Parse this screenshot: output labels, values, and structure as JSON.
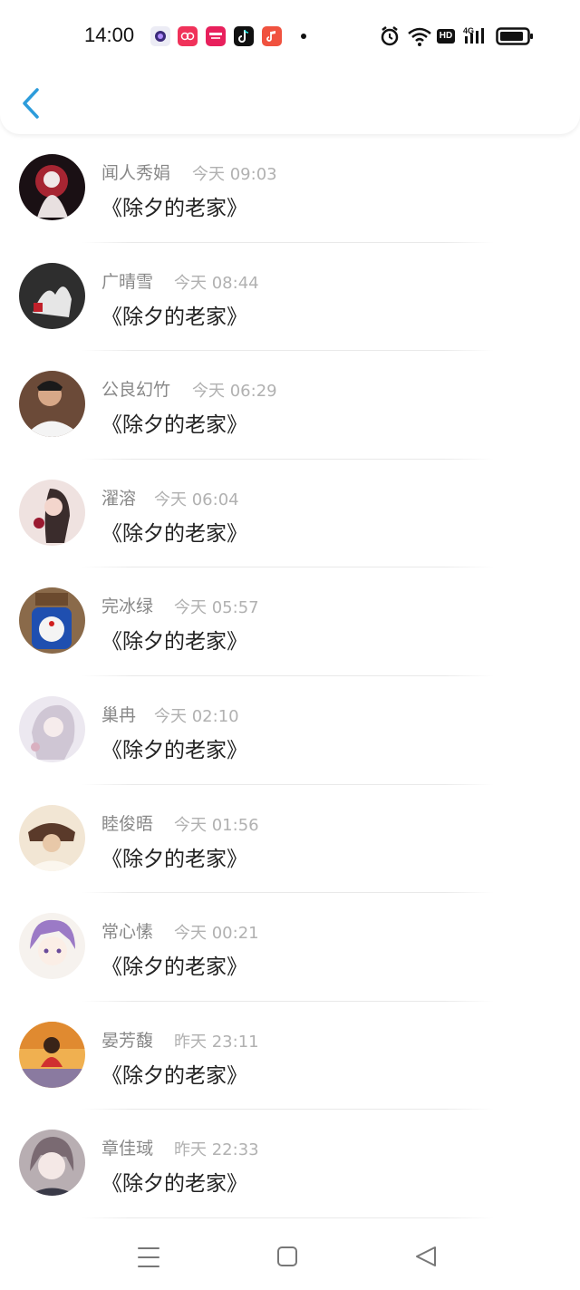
{
  "status_bar": {
    "time": "14:00",
    "app_icons": [
      "purple-dot-app-icon",
      "pink-app-icon",
      "pink-shop-app-icon",
      "tiktok-icon",
      "music-app-icon"
    ],
    "system_icons": [
      "alarm-icon",
      "wifi-icon",
      "hd-icon",
      "signal-4g-icon",
      "battery-icon"
    ],
    "hd_label": "HD",
    "network_label": "4G"
  },
  "header": {
    "back_icon": "chevron-left-icon"
  },
  "comments": [
    {
      "name": "闻人秀娟",
      "time": "今天 09:03",
      "title": "《除夕的老家》"
    },
    {
      "name": "广晴雪",
      "time": "今天 08:44",
      "title": "《除夕的老家》"
    },
    {
      "name": "公良幻竹",
      "time": "今天 06:29",
      "title": "《除夕的老家》"
    },
    {
      "name": "濯溶",
      "time": "今天 06:04",
      "title": "《除夕的老家》"
    },
    {
      "name": "完冰绿",
      "time": "今天 05:57",
      "title": "《除夕的老家》"
    },
    {
      "name": "巢冉",
      "time": "今天 02:10",
      "title": "《除夕的老家》"
    },
    {
      "name": "睦俊晤",
      "time": "今天 01:56",
      "title": "《除夕的老家》"
    },
    {
      "name": "常心愫",
      "time": "今天 00:21",
      "title": "《除夕的老家》"
    },
    {
      "name": "晏芳馥",
      "time": "昨天 23:11",
      "title": "《除夕的老家》"
    },
    {
      "name": "章佳琙",
      "time": "昨天 22:33",
      "title": "《除夕的老家》"
    }
  ],
  "nav_bar": {
    "items": [
      "menu-icon",
      "home-square-icon",
      "back-triangle-icon"
    ]
  },
  "colors": {
    "accent": "#2d9cdb",
    "name_text": "#888888",
    "time_text": "#b1b1b1",
    "title_text": "#222222"
  }
}
